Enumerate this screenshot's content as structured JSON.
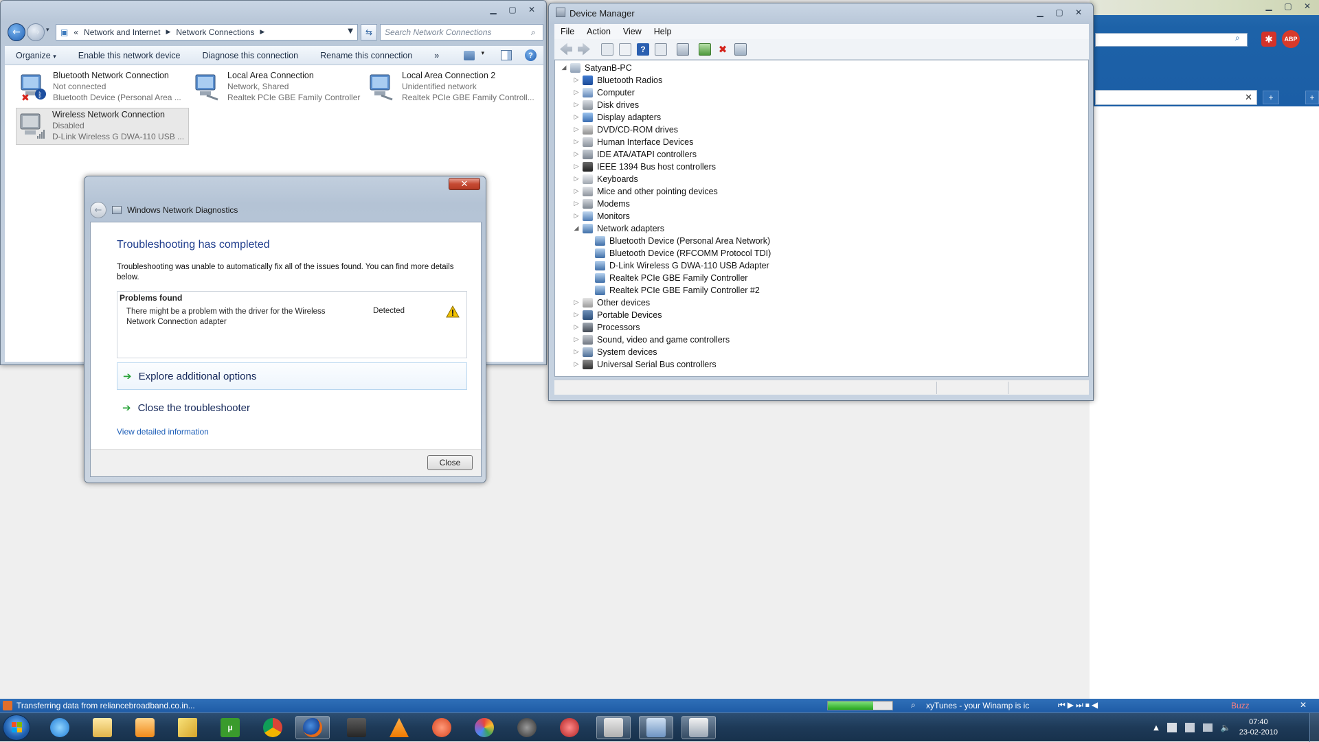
{
  "network_connections": {
    "breadcrumb": [
      "Network and Internet",
      "Network Connections"
    ],
    "search_placeholder": "Search Network Connections",
    "toolbar": {
      "organize": "Organize",
      "enable": "Enable this network device",
      "diagnose": "Diagnose this connection",
      "rename": "Rename this connection",
      "more": "»"
    },
    "connections": [
      {
        "name": "Bluetooth Network Connection",
        "status": "Not connected",
        "device": "Bluetooth Device (Personal Area ..."
      },
      {
        "name": "Local Area Connection",
        "status": "Network, Shared",
        "device": "Realtek PCIe GBE Family Controller"
      },
      {
        "name": "Local Area Connection 2",
        "status": "Unidentified network",
        "device": "Realtek PCIe GBE Family Controll..."
      },
      {
        "name": "Wireless Network Connection",
        "status": "Disabled",
        "device": "D-Link Wireless G DWA-110 USB ..."
      }
    ]
  },
  "device_manager": {
    "title": "Device Manager",
    "menu": [
      "File",
      "Action",
      "View",
      "Help"
    ],
    "root": "SatyanB-PC",
    "categories": [
      "Bluetooth Radios",
      "Computer",
      "Disk drives",
      "Display adapters",
      "DVD/CD-ROM drives",
      "Human Interface Devices",
      "IDE ATA/ATAPI controllers",
      "IEEE 1394 Bus host controllers",
      "Keyboards",
      "Mice and other pointing devices",
      "Modems",
      "Monitors",
      "Network adapters"
    ],
    "network_adapters": [
      "Bluetooth Device (Personal Area Network)",
      "Bluetooth Device (RFCOMM Protocol TDI)",
      "D-Link Wireless G DWA-110 USB Adapter",
      "Realtek PCIe GBE Family Controller",
      "Realtek PCIe GBE Family Controller #2"
    ],
    "categories_after": [
      "Other devices",
      "Portable Devices",
      "Processors",
      "Sound, video and game controllers",
      "System devices",
      "Universal Serial Bus controllers"
    ]
  },
  "diagnostics": {
    "title": "Windows Network Diagnostics",
    "heading": "Troubleshooting has completed",
    "message": "Troubleshooting was unable to automatically fix all of the issues found. You can find more details below.",
    "problems_header": "Problems found",
    "problem_text": "There might be a problem with the driver for the Wireless Network Connection adapter",
    "problem_status": "Detected",
    "option_explore": "Explore additional options",
    "option_close": "Close the troubleshooter",
    "detail_link": "View detailed information",
    "close_button": "Close"
  },
  "status_strip": {
    "transfer": "Transferring data from reliancebroadband.co.in...",
    "xytunes": "xyTunes - your Winamp is ic",
    "buzz": "Buzz"
  },
  "taskbar": {
    "time": "07:40",
    "date": "23-02-2010"
  },
  "colors": {
    "accent_blue": "#1e3c8c",
    "link_blue": "#1e5fb8",
    "taskbar": "#1e3a58",
    "warning": "#f2c200"
  }
}
